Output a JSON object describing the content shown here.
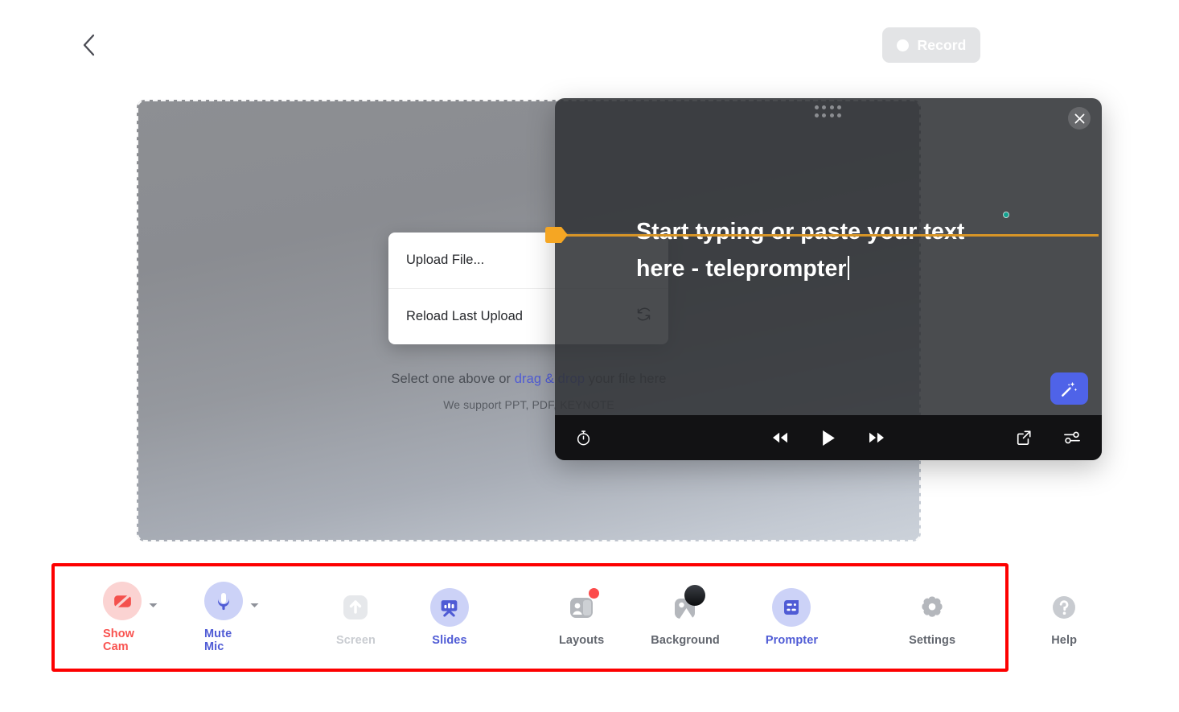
{
  "header": {
    "back_icon": "chevron-left-icon",
    "record": {
      "label": "Record",
      "dot_icon": "record-dot-icon",
      "bg_color": "#e3e4e6",
      "text_color": "#ffffff"
    }
  },
  "stage": {
    "hint_prefix": "Select one above or ",
    "hint_link": "drag & drop",
    "hint_suffix": " your file here",
    "sub": "We support PPT, PDF, KEYNOTE",
    "link_color": "#4f5bd5"
  },
  "upload_menu": {
    "items": [
      {
        "label": "Upload File...",
        "icon": ""
      },
      {
        "label": "Reload Last Upload",
        "icon": "reload-icon"
      }
    ]
  },
  "prompter": {
    "text_line1": "Start typing or paste your text",
    "text_line2": "here - teleprompter",
    "grip_icon": "drag-grip-icon",
    "close_icon": "close-icon",
    "marker_color": "#d79527",
    "status_dot_color": "#12a290",
    "controls": {
      "timer": "timer-icon",
      "rewind": "rewind-icon",
      "play": "play-icon",
      "forward": "fast-forward-icon",
      "popout": "external-link-icon",
      "settings": "sliders-icon"
    }
  },
  "wand": {
    "icon": "magic-wand-icon",
    "color": "#4f63e8"
  },
  "toolbar": {
    "highlight_color": "#fd0000",
    "items": [
      {
        "name": "show-cam",
        "label": "Show Cam",
        "icon": "camera-off-icon",
        "icon_color": "#f4514d",
        "bg": "#fbd3d2",
        "label_class": "lbl-red",
        "caret": true,
        "badge": "none"
      },
      {
        "name": "mute-mic",
        "label": "Mute Mic",
        "icon": "microphone-icon",
        "icon_color": "#4f5bd5",
        "bg": "#ccd2f7",
        "label_class": "lbl-blue",
        "caret": true,
        "badge": "none"
      },
      {
        "name": "screen",
        "label": "Screen",
        "icon": "screen-share-icon",
        "icon_color": "#ffffff",
        "bg": "#e6e8eb",
        "label_class": "lbl-faint",
        "caret": false,
        "badge": "none"
      },
      {
        "name": "slides",
        "label": "Slides",
        "icon": "slides-icon",
        "icon_color": "#4f5bd5",
        "bg": "#ccd2f7",
        "label_class": "lbl-blue",
        "caret": false,
        "badge": "none"
      },
      {
        "name": "layouts",
        "label": "Layouts",
        "icon": "layouts-icon",
        "icon_color": "#ffffff",
        "bg": "transparent",
        "label_class": "lbl-grey",
        "caret": false,
        "badge": "dot"
      },
      {
        "name": "background",
        "label": "Background",
        "icon": "background-icon",
        "icon_color": "#ffffff",
        "bg": "transparent",
        "label_class": "lbl-grey",
        "caret": false,
        "badge": "gradient"
      },
      {
        "name": "prompter",
        "label": "Prompter",
        "icon": "prompter-icon",
        "icon_color": "#4f5bd5",
        "bg": "#ccd2f7",
        "label_class": "lbl-blue",
        "caret": false,
        "badge": "none"
      },
      {
        "name": "settings",
        "label": "Settings",
        "icon": "gear-icon",
        "icon_color": "#ffffff",
        "bg": "transparent",
        "label_class": "lbl-grey",
        "caret": false,
        "badge": "none"
      },
      {
        "name": "help",
        "label": "Help",
        "icon": "help-icon",
        "icon_color": "#ffffff",
        "bg": "transparent",
        "label_class": "lbl-grey",
        "caret": false,
        "badge": "none"
      }
    ]
  }
}
